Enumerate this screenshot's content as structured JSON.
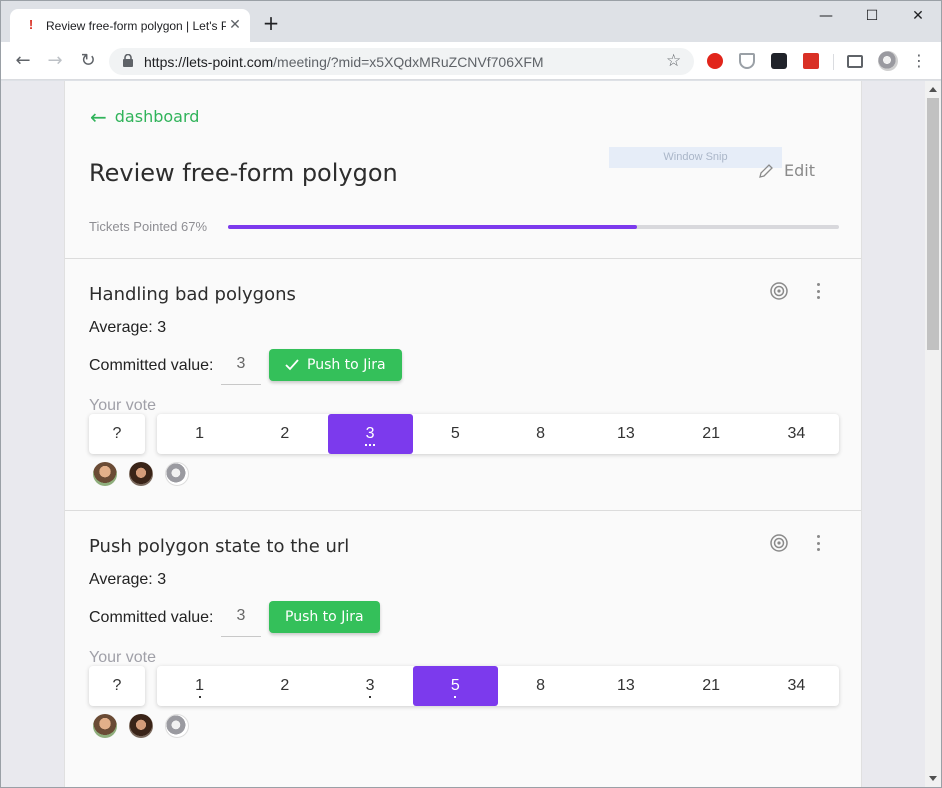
{
  "browser": {
    "tab_title": "Review free-form polygon | Let's Point",
    "tab_favicon": "!",
    "url_host": "https://lets-point.com",
    "url_path": "/meeting/?mid=x5XQdxMRuZCNVf706XFM"
  },
  "header": {
    "back_label": "dashboard",
    "title": "Review free-form polygon",
    "edit_label": "Edit",
    "snip_label": "Window Snip",
    "progress_label": "Tickets Pointed 67%",
    "progress_value": 0.67
  },
  "colors": {
    "accent": "#7c3aed",
    "green": "#34c05a",
    "link": "#30b35a"
  },
  "tickets": [
    {
      "title": "Handling bad polygons",
      "average": "Average: 3",
      "committed_label": "Committed value:",
      "committed_value": "3",
      "push_label": "Push to Jira",
      "pushed": true,
      "vote_label": "Your vote",
      "unknown": "?",
      "options": [
        "1",
        "2",
        "3",
        "5",
        "8",
        "13",
        "21",
        "34"
      ],
      "selected": "3",
      "dots": {
        "3": 3
      }
    },
    {
      "title": "Push polygon state to the url",
      "average": "Average: 3",
      "committed_label": "Committed value:",
      "committed_value": "3",
      "push_label": "Push to Jira",
      "pushed": false,
      "vote_label": "Your vote",
      "unknown": "?",
      "options": [
        "1",
        "2",
        "3",
        "5",
        "8",
        "13",
        "21",
        "34"
      ],
      "selected": "5",
      "dots": {
        "1": 1,
        "3": 1,
        "5": 1
      }
    }
  ]
}
